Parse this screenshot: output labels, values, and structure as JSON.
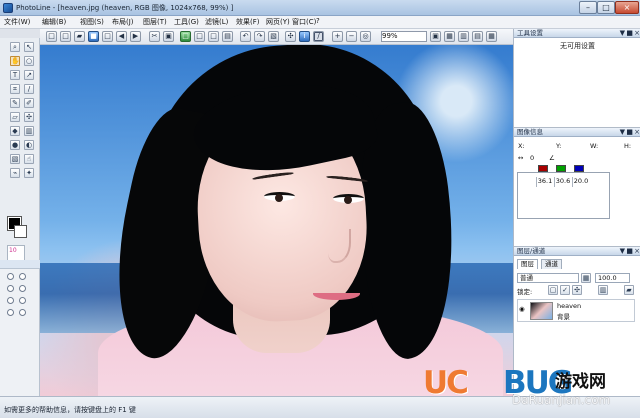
{
  "window": {
    "title": "PhotoLine - [heaven.jpg  (heaven, RGB 图像, 1024x768, 99%) ]",
    "minimize": "–",
    "maximize": "□",
    "close": "×"
  },
  "menu": [
    "文件(W)",
    "编辑(B)",
    "视图(S)",
    "布局(J)",
    "图层(T)",
    "工具(G)",
    "滤镜(L)",
    "效果(F)",
    "网页(Y)",
    "窗口(C)",
    "?"
  ],
  "toolbar": {
    "zoom_value": "99%"
  },
  "panels": {
    "tool_settings": {
      "title": "工具设置",
      "empty_text": "无可用设置"
    },
    "image_info": {
      "title": "图像信息",
      "x": "X:",
      "y": "Y:",
      "w": "W:",
      "h": "H:",
      "angle": "0",
      "values": [
        "36.1",
        "30.6",
        "20.0"
      ],
      "colors": [
        "#a80000",
        "#00a000",
        "#0000b8"
      ]
    },
    "layers": {
      "title": "图层/通道",
      "tabs": [
        "图层",
        "通道"
      ],
      "blend_mode": "普通",
      "opacity": "100.0",
      "lock": "锁定:",
      "layer_name": "heaven",
      "layer_sub": "背景"
    }
  },
  "status": {
    "help": "如需更多的帮助信息，请按键盘上的 F1 键"
  },
  "watermark": {
    "brand_left": "UC",
    "brand_right": "BUG",
    "brand_cn": "游戏网",
    "site": "DaRuanJian.com"
  }
}
